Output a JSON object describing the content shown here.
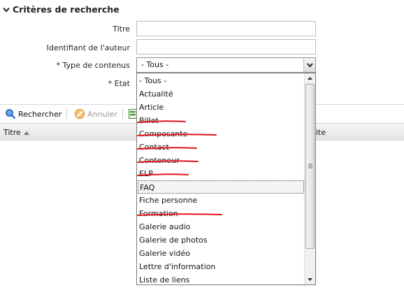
{
  "section": {
    "title": "Critères de recherche"
  },
  "form": {
    "title_label": "Titre",
    "title_value": "",
    "author_label": "Identifiant de l'auteur",
    "author_value": "",
    "type_label": "* Type de contenus",
    "type_value": "- Tous -",
    "state_label": "* Etat"
  },
  "toolbar": {
    "search_label": "Rechercher",
    "cancel_label": "Annuler"
  },
  "table": {
    "col_title": "Titre",
    "col_partial": "ite"
  },
  "dropdown": {
    "options": [
      "- Tous -",
      "Actualité",
      "Article",
      "Billet",
      "Composante",
      "Contact",
      "Conteneur",
      "ELP",
      "FAQ",
      "Fiche personne",
      "Formation",
      "Galerie audio",
      "Galerie de photos",
      "Galerie vidéo",
      "Lettre d'information",
      "Liste de liens"
    ],
    "highlighted": "FAQ",
    "struck_out": [
      "Billet",
      "Composante",
      "Contact",
      "Conteneur",
      "ELP",
      "Formation"
    ]
  },
  "colors": {
    "strike": "#e0141a",
    "search_icon": "#2f6fc0",
    "cancel_icon": "#f0a040"
  }
}
